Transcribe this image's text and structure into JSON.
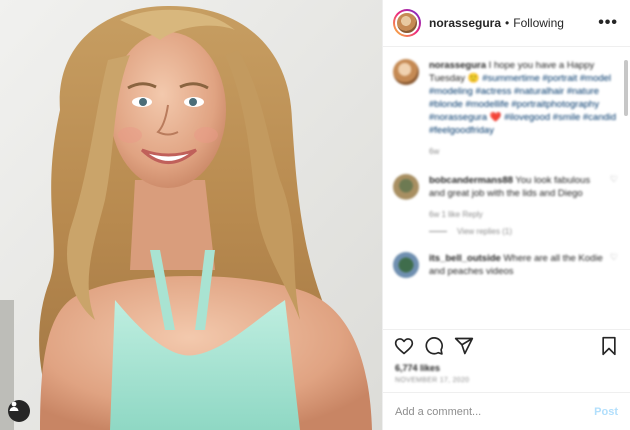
{
  "photo": {
    "alt": "Portrait of a smiling woman with long wavy blonde hair in a mint lace top",
    "tag_icon": "user-icon"
  },
  "header": {
    "username": "norassegura",
    "separator": "•",
    "follow_status": "Following",
    "more_icon": "more-options-icon",
    "more_glyph": "•••"
  },
  "comments": [
    {
      "username": "norassegura",
      "text": "I hope you have a Happy Tuesday 🙂",
      "hashtags": "#summertime #portrait #model #modeling #actress #naturalhair #nature #blonde #modellife #portraitphotography #norassegura ❤️ #ilovegood #smile #candid #feelgoodfriday",
      "meta": "6w"
    },
    {
      "username": "bobcandermans88",
      "text": "You look fabulous and great job with the lids and Diego",
      "meta": "6w   1 like   Reply",
      "view_replies": "View replies (1)"
    },
    {
      "username": "its_bell_outside",
      "text": "Where are all the Kodie and peaches videos",
      "meta": ""
    }
  ],
  "actions": {
    "like_icon": "heart-icon",
    "comment_icon": "comment-icon",
    "share_icon": "send-icon",
    "save_icon": "bookmark-icon"
  },
  "likes": "6,774 likes",
  "date": "NOVEMBER 17, 2020",
  "add_comment": {
    "placeholder": "Add a comment...",
    "post_label": "Post"
  },
  "colors": {
    "post_disabled": "#b2dffc",
    "hashtag": "#00376b",
    "meta": "#8e8e8e"
  }
}
